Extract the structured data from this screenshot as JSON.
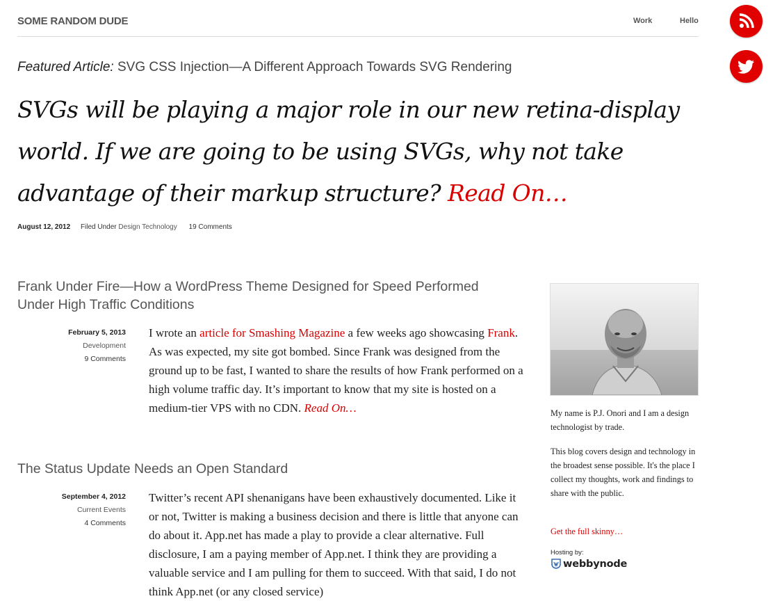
{
  "site": {
    "title": "SOME RANDOM DUDE"
  },
  "nav": {
    "work": "Work",
    "hello": "Hello"
  },
  "social": [
    {
      "name": "rss",
      "icon": "rss-icon",
      "color": "#e00000"
    },
    {
      "name": "twitter",
      "icon": "twitter-bird-icon",
      "color": "#e00000"
    }
  ],
  "featured": {
    "label": "Featured Article:",
    "title": "SVG CSS Injection—A Different Approach Towards SVG Rendering",
    "headline": "SVGs will be playing a major role in our new retina-display world. If we are going to be using SVGs, why not take advantage of their markup structure?",
    "read_on": "Read On…",
    "date": "August 12, 2012",
    "filed_under": "Filed Under",
    "category": "Design Technology",
    "comments": "19 Comments"
  },
  "posts": [
    {
      "title": "Frank Under Fire—How a WordPress Theme Designed for Speed Performed Under High Traffic Conditions",
      "date": "February 5, 2013",
      "category": "Development",
      "comments": "9 Comments",
      "body_1": "I wrote an ",
      "body_link_1": "article for Smashing Magazine",
      "body_2": " a few weeks ago showcasing ",
      "body_link_2": "Frank",
      "body_3": ". As was expected, my site got bombed. Since Frank was designed from the ground up to be fast, I wanted to share the results of how Frank performed on a high volume traffic day. It’s important to know that my site is hosted on a medium-tier VPS with no CDN. ",
      "read_on": "Read On…"
    },
    {
      "title": "The Status Update Needs an Open Standard",
      "date": "September 4, 2012",
      "category": "Current Events",
      "comments": "4 Comments",
      "body": "Twitter’s recent API shenanigans have been exhaustively documented. Like it or not, Twitter is making a business decision and there is little that anyone can do about it. App.net has made a play to provide a clear alternative. Full disclosure, I am a paying member of App.net. I think they are providing a valuable service and I am pulling for them to succeed. With that said, I do not think App.net (or any closed service)"
    }
  ],
  "sidebar": {
    "bio_1": "My name is P.J. Onori and I am a design technologist by trade.",
    "bio_2": "This blog covers design and technology in the broadest sense possible. It's the place I collect my thoughts, work and findings to share with the public.",
    "full_skinny": "Get the full skinny…",
    "hosting_label": "Hosting by:",
    "hosting_name": "webbynode"
  },
  "colors": {
    "accent": "#d80000",
    "social": "#e00000",
    "text": "#222222",
    "muted": "#555555"
  }
}
